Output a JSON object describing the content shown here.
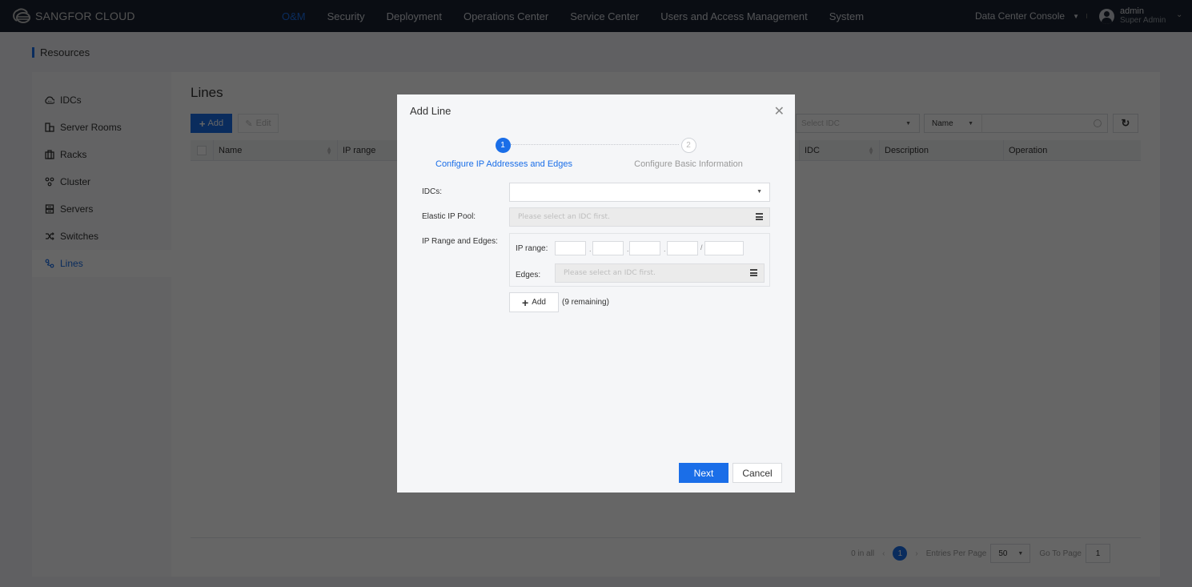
{
  "topbar": {
    "brand": "SANGFOR CLOUD",
    "nav": [
      "O&M",
      "Security",
      "Deployment",
      "Operations Center",
      "Service Center",
      "Users and Access Management",
      "System"
    ],
    "active_nav": "O&M",
    "console_label": "Data Center Console",
    "user_name": "admin",
    "user_role": "Super Admin"
  },
  "page": {
    "section_title": "Resources"
  },
  "sidebar": {
    "items": [
      {
        "label": "IDCs",
        "icon": "cloud-icon"
      },
      {
        "label": "Server Rooms",
        "icon": "building-icon"
      },
      {
        "label": "Racks",
        "icon": "rack-icon"
      },
      {
        "label": "Cluster",
        "icon": "cluster-icon"
      },
      {
        "label": "Servers",
        "icon": "server-icon"
      },
      {
        "label": "Switches",
        "icon": "switch-icon"
      },
      {
        "label": "Lines",
        "icon": "line-icon"
      }
    ],
    "active": "Lines"
  },
  "content": {
    "title": "Lines",
    "add_label": "Add",
    "edit_label": "Edit",
    "filter_idc_placeholder": "Select IDC",
    "filter_field": "Name",
    "columns": [
      "Name",
      "IP range",
      "IDC",
      "Description",
      "Operation"
    ]
  },
  "pager": {
    "total": "0 in all",
    "current_page": "1",
    "entries_label": "Entries Per Page",
    "entries_value": "50",
    "goto_label": "Go To Page",
    "goto_value": "1"
  },
  "modal": {
    "title": "Add Line",
    "steps": [
      {
        "number": "1",
        "label": "Configure IP Addresses and Edges",
        "state": "active"
      },
      {
        "number": "2",
        "label": "Configure Basic Information",
        "state": "inactive"
      }
    ],
    "idcs_label": "IDCs:",
    "idcs_value": "",
    "eip_label": "Elastic IP Pool:",
    "eip_placeholder": "Please select an IDC first.",
    "ip_edges_label": "IP Range and Edges:",
    "ip_range_label": "IP range:",
    "ip_octets": [
      "",
      "",
      "",
      ""
    ],
    "ip_mask": "",
    "edges_label": "Edges:",
    "edges_placeholder": "Please select an IDC first.",
    "add_label": "Add",
    "remaining": "(9 remaining)",
    "next_label": "Next",
    "cancel_label": "Cancel"
  },
  "colors": {
    "accent": "#1a6ee8",
    "topbar_bg": "#1b2230"
  }
}
